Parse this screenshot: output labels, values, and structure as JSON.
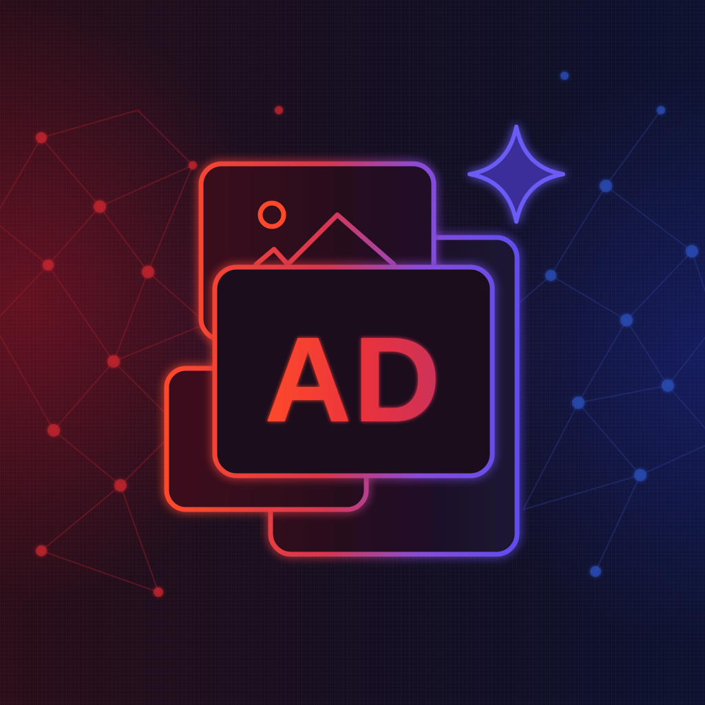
{
  "logo": {
    "text": "AD",
    "icon_names": [
      "image-icon",
      "sparkle-icon",
      "ad-card-icon",
      "network-pattern"
    ]
  },
  "colors": {
    "background_left": "#2a0d18",
    "background_right": "#0d1230",
    "accent_red": "#ff4a2a",
    "accent_purple": "#8a4cd8",
    "accent_blue": "#5a4ef0",
    "network_red": "#c0242e",
    "network_blue": "#2a4ab0"
  }
}
